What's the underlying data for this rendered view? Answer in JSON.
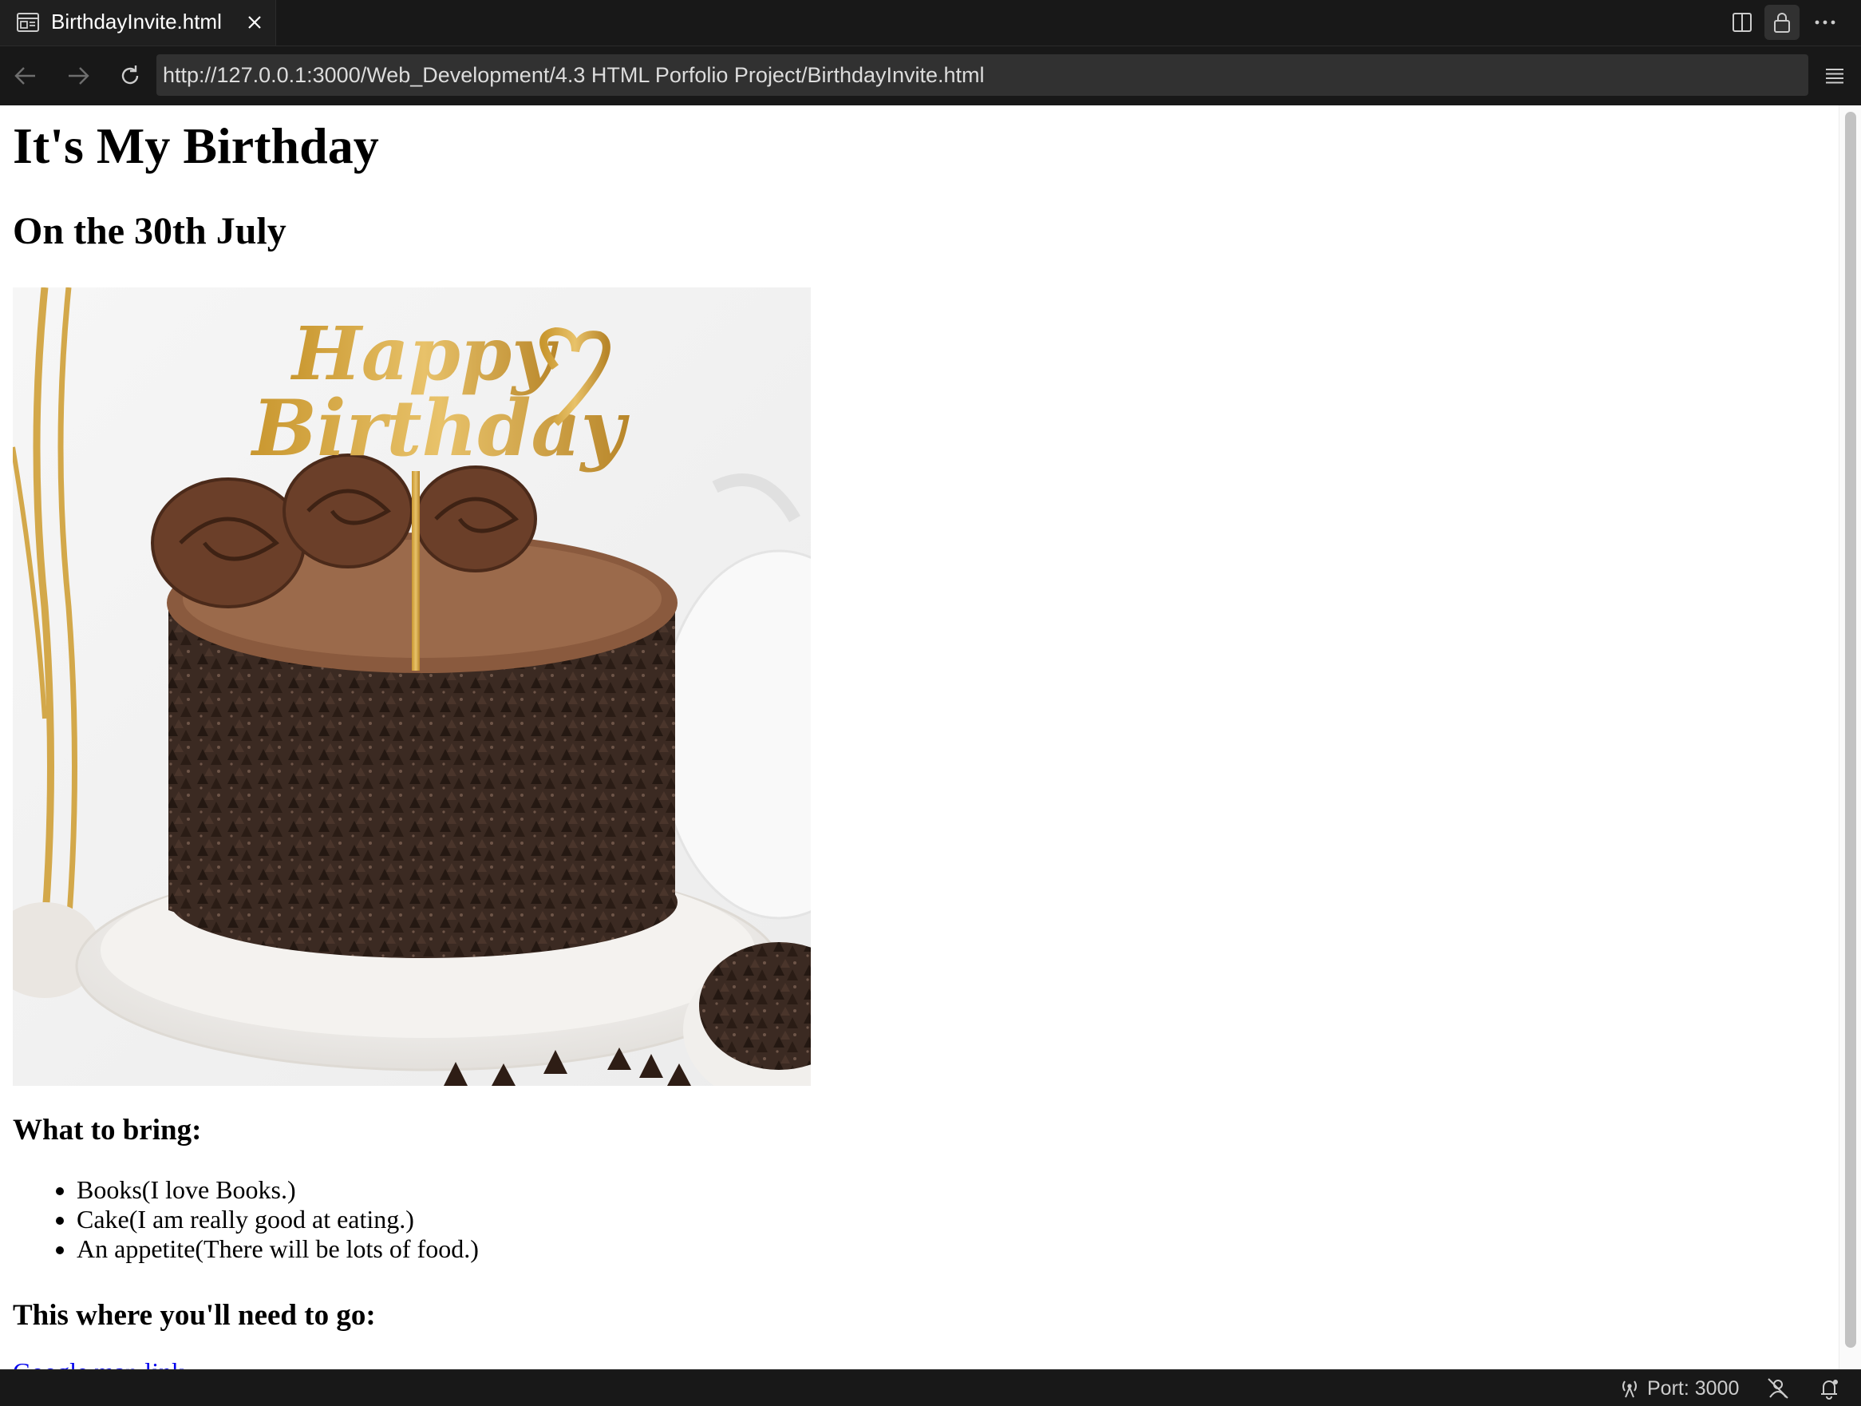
{
  "tab": {
    "title": "BirthdayInvite.html"
  },
  "address_bar": {
    "url": "http://127.0.0.1:3000/Web_Development/4.3 HTML Porfolio Project/BirthdayInvite.html"
  },
  "page": {
    "heading": "It's My Birthday",
    "subheading": "On the 30th July",
    "image": {
      "topper_text": "Happy Birthday"
    },
    "bring_heading": "What to bring:",
    "bring_items": [
      "Books(I love Books.)",
      "Cake(I am really good at eating.)",
      "An appetite(There will be lots of food.)"
    ],
    "location_heading": "This where you'll need to go:",
    "map_link": "Google map link"
  },
  "status_bar": {
    "port": "Port: 3000"
  },
  "icons": {
    "tab": "preview-page-icon",
    "close": "close-icon",
    "split": "split-editor-icon",
    "lock": "lock-icon",
    "more": "ellipsis-icon",
    "back": "arrow-left-icon",
    "forward": "arrow-right-icon",
    "reload": "reload-icon",
    "menu": "hamburger-menu-icon",
    "port": "broadcast-icon",
    "accounts": "no-accounts-icon",
    "bell": "bell-icon"
  },
  "colors": {
    "chrome": "#181818",
    "url_field": "#313131",
    "link": "#0000ee",
    "page_bg": "#ffffff"
  }
}
